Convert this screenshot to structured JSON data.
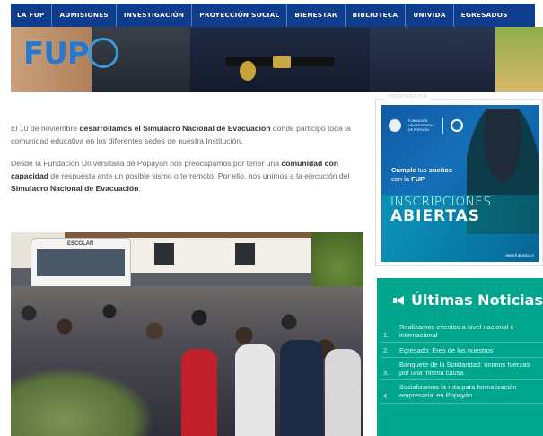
{
  "nav": {
    "items": [
      "LA FUP",
      "ADMISIONES",
      "INVESTIGACIÓN",
      "PROYECCIÓN SOCIAL",
      "BIENESTAR",
      "BIBLIOTECA",
      "UNIVIDA",
      "EGRESADOS"
    ]
  },
  "hero": {
    "logo_text": "FUP"
  },
  "article": {
    "p1_a": "El 10 de noviembre ",
    "p1_b": "desarrollamos el Simulacro Nacional de Evacuación",
    "p1_c": " donde participó toda la comunidad educativa en los diferentes sedes de nuestra Institución.",
    "p2_a": "Desde la Fundación Universitaria de Popayán nos preocupamos por tener una ",
    "p2_b": "comunidad con capacidad",
    "p2_c": " de respuesta ante un posible sismo o terremoto. Por ello, nos unimos a la ejecución del ",
    "p2_d": "Simulacro Nacional de Evacuación",
    "p2_e": "."
  },
  "photo": {
    "bus_label": "ESCOLAR"
  },
  "sidebar": {
    "info_label": "INFORMACIÓN",
    "banner": {
      "uni_line": "FUNDACIÓN UNIVERSITARIA DE POPAYÁN",
      "cumple_a": "Cumple",
      "cumple_b": " tus ",
      "cumple_c": "sueños",
      "cumple_d": "con la ",
      "cumple_e": "FUP",
      "inscripciones": "INSCRIPCIONES",
      "abiertas": "ABIERTAS",
      "url": "www.fup.edu.co"
    },
    "news": {
      "title": "Últimas Noticias",
      "items": [
        {
          "num": "1.",
          "text": "Realizamos eventos a nivel nacional e internacional"
        },
        {
          "num": "2.",
          "text": "Egresado: Eres de los nuestros"
        },
        {
          "num": "3.",
          "text": "Banquete de la Solidaridad: unimos fuerzas por una misma causa"
        },
        {
          "num": "4.",
          "text": "Socializamos la ruta para formalización empresarial en Popayán"
        }
      ]
    }
  },
  "colors": {
    "nav_bg": "#0d3d8c",
    "news_bg": "#00a58e",
    "banner_bg": "#1570b8"
  }
}
